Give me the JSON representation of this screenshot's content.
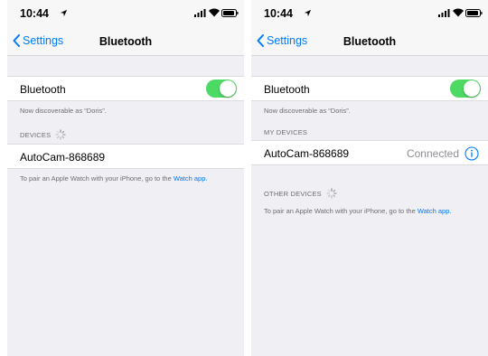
{
  "left": {
    "status_time": "10:44",
    "nav": {
      "back_label": "Settings",
      "title": "Bluetooth"
    },
    "bluetooth_label": "Bluetooth",
    "bluetooth_on": true,
    "discoverable_note": "Now discoverable as “Doris”.",
    "devices_header": "DEVICES",
    "device_name": "AutoCam-868689",
    "footer_text": "To pair an Apple Watch with your iPhone, go to the ",
    "footer_link": "Watch app."
  },
  "right": {
    "status_time": "10:44",
    "nav": {
      "back_label": "Settings",
      "title": "Bluetooth"
    },
    "bluetooth_label": "Bluetooth",
    "bluetooth_on": true,
    "discoverable_note": "Now discoverable as “Doris”.",
    "my_devices_header": "MY DEVICES",
    "device_name": "AutoCam-868689",
    "device_status": "Connected",
    "other_devices_header": "OTHER DEVICES",
    "footer_text": "To pair an Apple Watch with your iPhone, go to the ",
    "footer_link": "Watch app."
  },
  "icons": {
    "location": "location-arrow-icon",
    "signal": "cellular-signal-icon",
    "wifi": "wifi-icon",
    "battery": "battery-icon",
    "back": "chevron-left-icon",
    "spinner": "activity-spinner-icon",
    "info": "info-circle-icon"
  },
  "colors": {
    "accent": "#007aff",
    "toggle_on": "#4cd964",
    "background": "#efeff4",
    "secondary_text": "#6d6d72"
  }
}
